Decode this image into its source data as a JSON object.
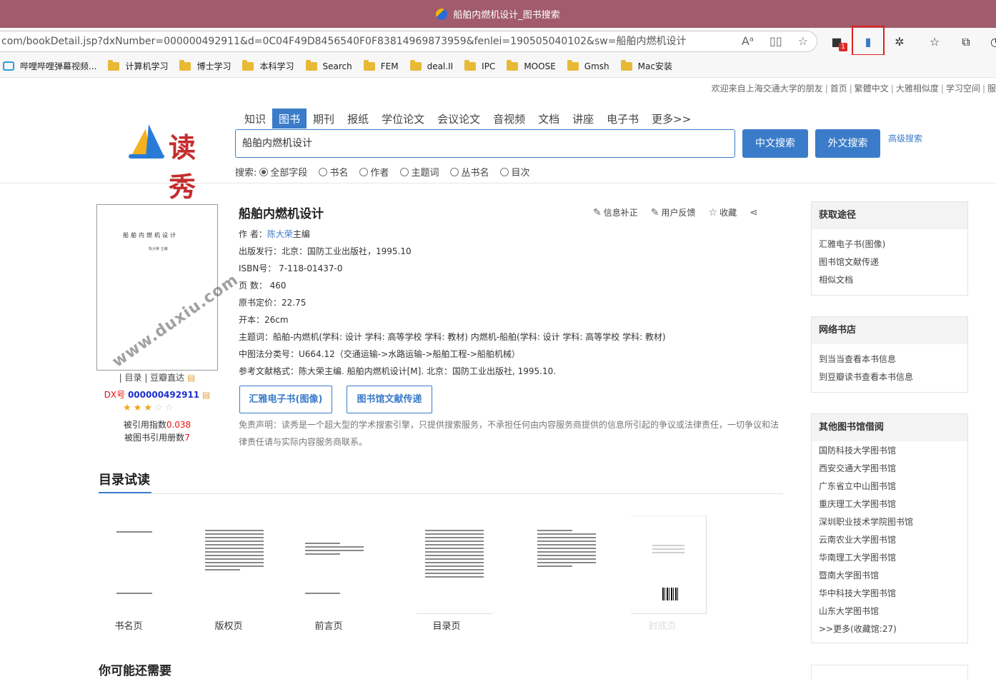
{
  "browser": {
    "window_title": "船舶内燃机设计_图书搜索",
    "url": "com/bookDetail.jsp?dxNumber=000000492911&d=0C04F49D8456540F0F83814969873959&fenlei=190505040102&sw=船舶内燃机设计",
    "badge_count": "1",
    "bookmarks": [
      "哔哩哔哩弹幕视频...",
      "计算机学习",
      "博士学习",
      "本科学习",
      "Search",
      "FEM",
      "deal.II",
      "IPC",
      "MOOSE",
      "Gmsh",
      "Mac安装"
    ]
  },
  "topbar": {
    "welcome": "欢迎来自上海交通大学的朋友",
    "links": [
      "首页",
      "繁體中文",
      "大雅相似度",
      "学习空间",
      "服"
    ]
  },
  "logo_text": "读秀",
  "nav_tabs": [
    "知识",
    "图书",
    "期刊",
    "报纸",
    "学位论文",
    "会议论文",
    "音视频",
    "文档",
    "讲座",
    "电子书",
    "更多>>"
  ],
  "active_tab": "图书",
  "search": {
    "query": "船舶内燃机设计",
    "btn_cn": "中文搜索",
    "btn_foreign": "外文搜索",
    "advanced": "高级搜索",
    "scope_label": "搜索:",
    "scopes": [
      "全部字段",
      "书名",
      "作者",
      "主题词",
      "丛书名",
      "目次"
    ]
  },
  "book": {
    "title": "船舶内燃机设计",
    "cover_title": "船舶内燃机设计",
    "cover_sub": "陈大荣 主编",
    "watermark": "www.duxiu.com",
    "author_label": "作 者：",
    "author": "陈大荣",
    "author_suffix": "主编",
    "publisher": "出版发行：北京：国防工业出版社，1995.10",
    "isbn": "ISBN号： 7-118-01437-0",
    "pages": "页 数： 460",
    "price": "原书定价：22.75",
    "format": "开本：26cm",
    "subject": "主题词：船舶-内燃机(学科: 设计 学科: 高等学校 学科: 教材) 内燃机-船舶(学科: 设计 学科: 高等学校 学科: 教材)",
    "clc": "中图法分类号：U664.12（交通运输->水路运输->船舶工程->船舶机械）",
    "reference": "参考文献格式：陈大荣主编. 船舶内燃机设计[M]. 北京：国防工业出版社, 1995.10.",
    "btn_ebook": "汇雅电子书(图像)",
    "btn_delivery": "图书馆文献传递",
    "disclaimer": "免责声明：读秀是一个超大型的学术搜索引擎，只提供搜索服务，不承担任何由内容服务商提供的信息所引起的争议或法律责任，一切争议和法律责任请与实际内容服务商联系。",
    "actions": [
      "信息补正",
      "用户反馈",
      "收藏"
    ]
  },
  "left_info": {
    "links": "| 目录 | 豆瓣直达",
    "dx_label": "DX号",
    "dx_number": "000000492911",
    "rating": 3,
    "rating_max": 5,
    "cite_label": "被引用指数",
    "cite_value": "0.038",
    "lib_label": "被图书引用册数",
    "lib_value": "7"
  },
  "preview": {
    "heading": "目录试读",
    "items": [
      "书名页",
      "版权页",
      "前言页",
      "目录页",
      "",
      "封底页"
    ],
    "also_heading": "你可能还需要"
  },
  "sidebar": {
    "access": {
      "title": "获取途径",
      "items": [
        "汇雅电子书(图像)",
        "图书馆文献传递",
        "相似文档"
      ]
    },
    "stores": {
      "title": "网络书店",
      "items": [
        "到当当查看本书信息",
        "到豆瓣读书查看本书信息"
      ]
    },
    "libraries": {
      "title": "其他图书馆借阅",
      "items": [
        "国防科技大学图书馆",
        "西安交通大学图书馆",
        "广东省立中山图书馆",
        "重庆理工大学图书馆",
        "深圳职业技术学院图书馆",
        "云南农业大学图书馆",
        "华南理工大学图书馆",
        "暨南大学图书馆",
        "华中科技大学图书馆",
        "山东大学图书馆",
        ">>更多(收藏馆:27)"
      ]
    }
  },
  "colors": {
    "titlebar": "#a15b6d",
    "accent": "#3a7cc9",
    "highlight_box": "#e0201c"
  }
}
